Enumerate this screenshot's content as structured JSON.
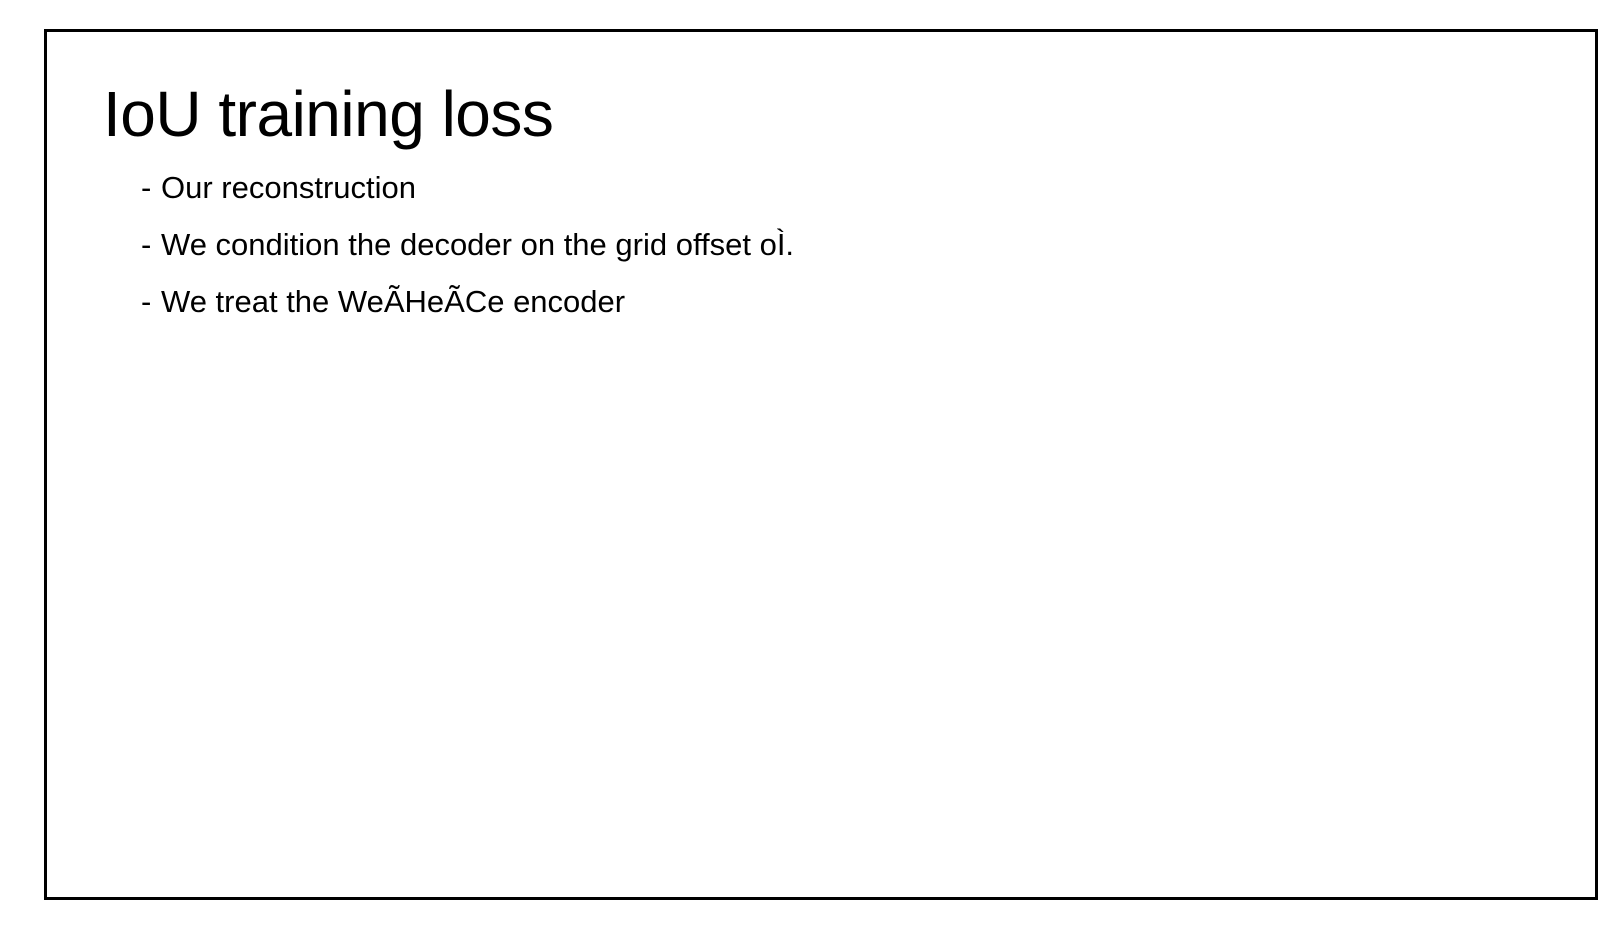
{
  "slide": {
    "title": "IoU training loss",
    "bullets": [
      {
        "dash": "-",
        "text": "Our reconstruction"
      },
      {
        "dash": "-",
        "text": "We condition the decoder on the grid offset oÌ\u0003."
      },
      {
        "dash": "-",
        "text": "We treat the WeÃ\u0003HeÃ\u0003Ce encoder"
      }
    ]
  },
  "colors": {
    "border": "#000000",
    "text": "#000000",
    "background": "#ffffff"
  }
}
